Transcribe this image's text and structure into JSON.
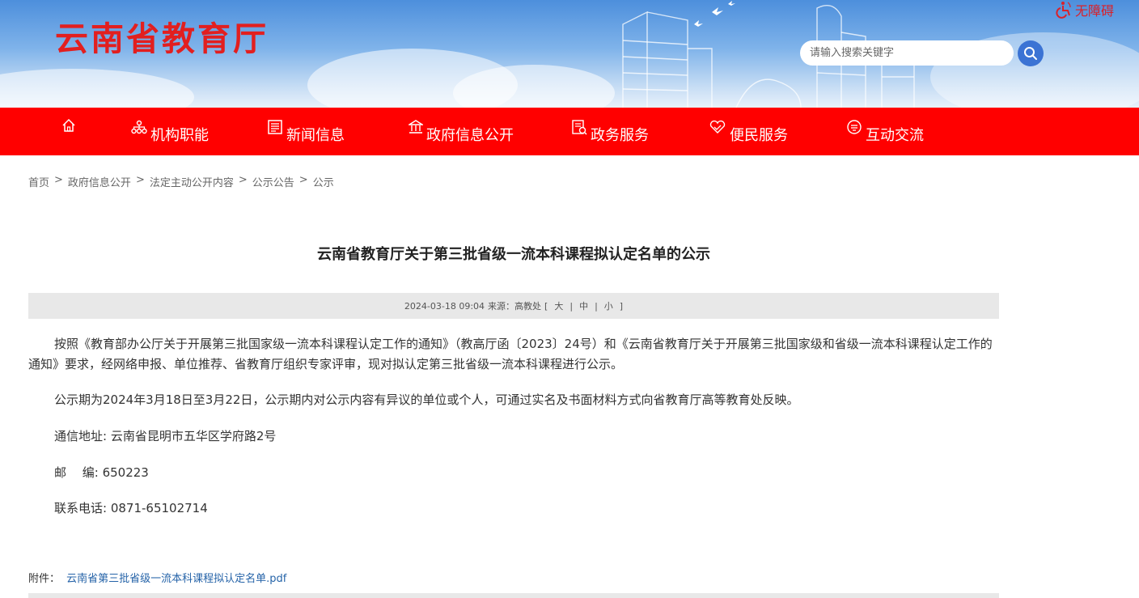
{
  "header": {
    "site_title": "云南省教育厅",
    "accessibility_label": "无障碍",
    "search_placeholder": "请输入搜索关键字"
  },
  "nav": {
    "items": [
      {
        "label": "机构职能",
        "icon": "org-chart-icon"
      },
      {
        "label": "新闻信息",
        "icon": "newspaper-icon"
      },
      {
        "label": "政府信息公开",
        "icon": "government-building-icon"
      },
      {
        "label": "政务服务",
        "icon": "service-doc-icon"
      },
      {
        "label": "便民服务",
        "icon": "handshake-heart-icon"
      },
      {
        "label": "互动交流",
        "icon": "chat-icon"
      }
    ],
    "home_icon": "home-icon"
  },
  "breadcrumb": {
    "items": [
      "首页",
      "政府信息公开",
      "法定主动公开内容",
      "公示公告",
      "公示"
    ],
    "separator": ">"
  },
  "article": {
    "title": "云南省教育厅关于第三批省级一流本科课程拟认定名单的公示",
    "meta": {
      "datetime": "2024-03-18 09:04",
      "source_label": "来源：",
      "source": "高教处",
      "font_open": "[",
      "font_large": "大",
      "font_medium": "中",
      "font_small": "小",
      "font_close": "]",
      "sep": "|"
    },
    "paragraphs": [
      "按照《教育部办公厅关于开展第三批国家级一流本科课程认定工作的通知》（教高厅函〔2023〕24号）和《云南省教育厅关于开展第三批国家级和省级一流本科课程认定工作的通知》要求，经网络申报、单位推荐、省教育厅组织专家评审，现对拟认定第三批省级一流本科课程进行公示。",
      "公示期为2024年3月18日至3月22日，公示期内对公示内容有异议的单位或个人，可通过实名及书面材料方式向省教育厅高等教育处反映。",
      "通信地址: 云南省昆明市五华区学府路2号",
      "邮　 编: 650223",
      "联系电话: 0871-65102714"
    ],
    "attachment_label": "附件：",
    "attachment_file": "云南省第三批省级一流本科课程拟认定名单.pdf"
  },
  "colors": {
    "nav_bg": "#ff0000",
    "title_red": "#e21f1f",
    "search_button": "#3b73d4",
    "link_blue": "#2563a8"
  }
}
